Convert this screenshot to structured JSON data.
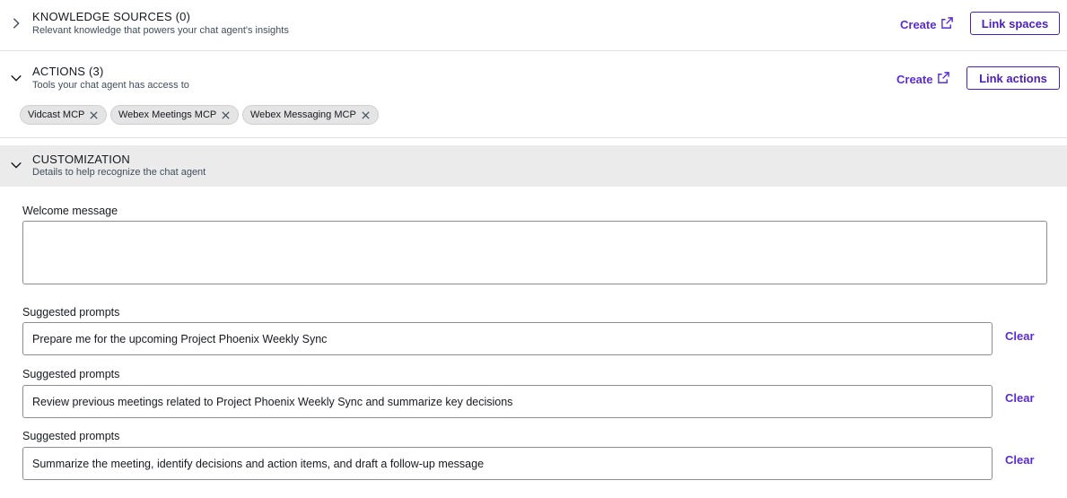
{
  "knowledge": {
    "title": "KNOWLEDGE SOURCES (0)",
    "subtitle": "Relevant knowledge that powers your chat agent's insights",
    "create_label": "Create",
    "link_label": "Link spaces",
    "expanded": false
  },
  "actions": {
    "title": "ACTIONS (3)",
    "subtitle": "Tools your chat agent has access to",
    "create_label": "Create",
    "link_label": "Link actions",
    "expanded": true,
    "chips": [
      "Vidcast MCP",
      "Webex Meetings MCP",
      "Webex Messaging MCP"
    ]
  },
  "customization": {
    "title": "CUSTOMIZATION",
    "subtitle": "Details to help recognize the chat agent",
    "expanded": true,
    "welcome_label": "Welcome message",
    "welcome_value": "",
    "prompts": [
      {
        "label": "Suggested prompts",
        "value": "Prepare me for the upcoming Project Phoenix Weekly Sync",
        "clear_label": "Clear"
      },
      {
        "label": "Suggested prompts",
        "value": "Review previous meetings related to Project Phoenix Weekly Sync and summarize key decisions",
        "clear_label": "Clear"
      },
      {
        "label": "Suggested prompts",
        "value": "Summarize the meeting, identify decisions and action items, and draft a follow-up message",
        "clear_label": "Clear"
      }
    ]
  },
  "colors": {
    "accent": "#5a2bd6",
    "button_border": "#4b1fb8",
    "band": "#ebebeb",
    "chip_bg": "#e4e4e4"
  }
}
